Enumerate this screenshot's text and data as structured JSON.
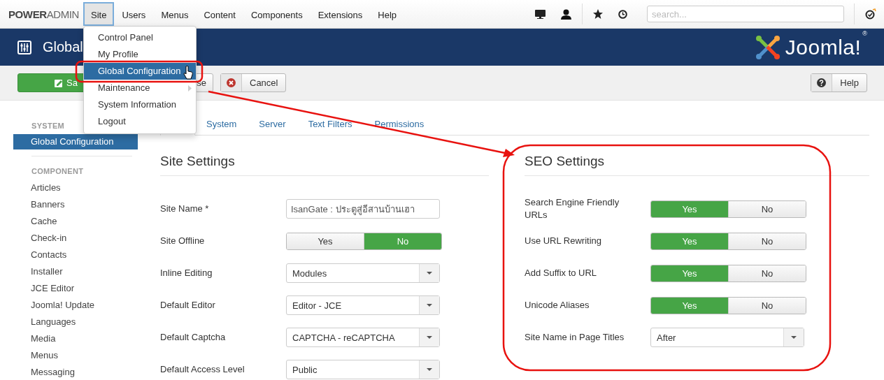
{
  "navbar": {
    "brand": "**POWER**ADMIN",
    "menu": [
      {
        "label": "Site",
        "selected": true
      },
      {
        "label": "Users",
        "selected": false
      },
      {
        "label": "Menus",
        "selected": false
      },
      {
        "label": "Content",
        "selected": false
      },
      {
        "label": "Components",
        "selected": false
      },
      {
        "label": "Extensions",
        "selected": false
      },
      {
        "label": "Help",
        "selected": false
      }
    ],
    "search": {
      "placeholder": "search..."
    }
  },
  "site_menu": {
    "items": [
      {
        "label": "Control Panel",
        "kind": "item",
        "selected": false
      },
      {
        "label": "My Profile",
        "kind": "item",
        "selected": false
      },
      {
        "label": "Global Configuration",
        "kind": "item",
        "selected": true
      },
      {
        "label": "Maintenance",
        "kind": "submenu",
        "selected": false
      },
      {
        "label": "System Information",
        "kind": "item",
        "selected": false
      },
      {
        "label": "Logout",
        "kind": "item",
        "selected": false
      }
    ]
  },
  "header": {
    "title": "Global",
    "logo_text": "Joomla!",
    "logo_mark": "®"
  },
  "toolbar": {
    "buttons": [
      {
        "label": "Sa",
        "kind": "save"
      },
      {
        "label": "se",
        "kind": "plain"
      },
      {
        "label": "Cancel",
        "kind": "cancel"
      },
      {
        "label": "Help",
        "kind": "help"
      }
    ]
  },
  "sidebar": {
    "sections": [
      {
        "heading": "SYSTEM",
        "items": [
          {
            "label": "Global Configuration",
            "selected": true
          }
        ]
      },
      {
        "heading": "COMPONENT",
        "items": [
          {
            "label": "Articles",
            "selected": false
          },
          {
            "label": "Banners",
            "selected": false
          },
          {
            "label": "Cache",
            "selected": false
          },
          {
            "label": "Check-in",
            "selected": false
          },
          {
            "label": "Contacts",
            "selected": false
          },
          {
            "label": "Installer",
            "selected": false
          },
          {
            "label": "JCE Editor",
            "selected": false
          },
          {
            "label": "Joomla! Update",
            "selected": false
          },
          {
            "label": "Languages",
            "selected": false
          },
          {
            "label": "Media",
            "selected": false
          },
          {
            "label": "Menus",
            "selected": false
          },
          {
            "label": "Messaging",
            "selected": false
          }
        ]
      }
    ]
  },
  "tabs": [
    {
      "selected": true
    },
    {
      "label": "System",
      "selected": false
    },
    {
      "label": "Server",
      "selected": false
    },
    {
      "label": "Text Filters",
      "selected": false
    },
    {
      "label": "Permissions",
      "selected": false
    }
  ],
  "site_settings": {
    "title": "Site Settings",
    "fields": [
      {
        "label": "Site Name *",
        "kind": "text",
        "value": "IsanGate : ประตูสู่อีสานบ้านเฮา"
      },
      {
        "label": "Site Offline",
        "kind": "toggle",
        "options": [
          {
            "label": "Yes",
            "selected": false
          },
          {
            "label": "No",
            "selected": true
          }
        ]
      },
      {
        "label": "Inline Editing",
        "kind": "select",
        "value": "Modules"
      },
      {
        "label": "Default Editor",
        "kind": "select",
        "value": "Editor - JCE"
      },
      {
        "label": "Default Captcha",
        "kind": "select",
        "value": "CAPTCHA - reCAPTCHA"
      },
      {
        "label": "Default Access Level",
        "kind": "select",
        "value": "Public"
      }
    ]
  },
  "seo_settings": {
    "title": "SEO Settings",
    "fields": [
      {
        "label": "Search Engine Friendly URLs",
        "kind": "toggle",
        "options": [
          {
            "label": "Yes",
            "selected": true
          },
          {
            "label": "No",
            "selected": false
          }
        ]
      },
      {
        "label": "Use URL Rewriting",
        "kind": "toggle",
        "options": [
          {
            "label": "Yes",
            "selected": true
          },
          {
            "label": "No",
            "selected": false
          }
        ]
      },
      {
        "label": "Add Suffix to URL",
        "kind": "toggle",
        "options": [
          {
            "label": "Yes",
            "selected": true
          },
          {
            "label": "No",
            "selected": false
          }
        ]
      },
      {
        "label": "Unicode Aliases",
        "kind": "toggle",
        "options": [
          {
            "label": "Yes",
            "selected": true
          },
          {
            "label": "No",
            "selected": false
          }
        ]
      },
      {
        "label": "Site Name in Page Titles",
        "kind": "select",
        "value": "After"
      }
    ]
  }
}
